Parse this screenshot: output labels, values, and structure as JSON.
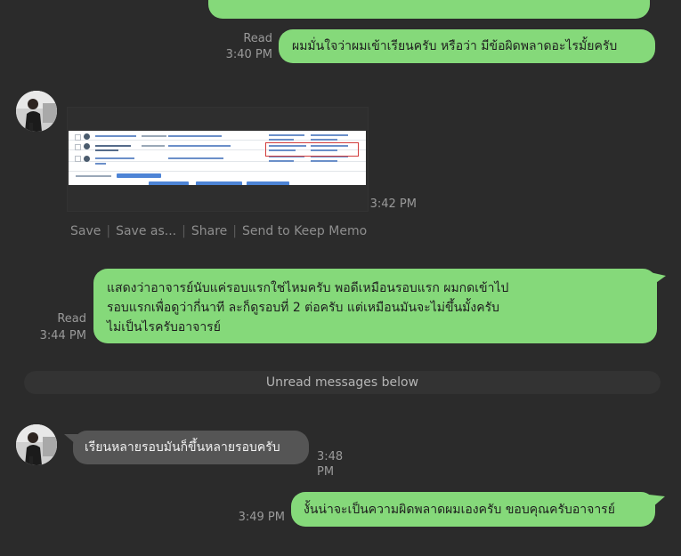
{
  "messages": [
    {
      "id": "m1",
      "from": "me",
      "text": "ผมมั่นใจว่าผมเข้าเรียนครับ หรือว่า มีข้อผิดพลาดอะไรมั้ยครับ",
      "read": "Read",
      "time": "3:40 PM"
    },
    {
      "id": "m2",
      "from": "other",
      "type": "image",
      "time": "3:42 PM"
    },
    {
      "id": "m3",
      "from": "me",
      "lines": [
        "แสดงว่าอาจารย์นับแค่รอบแรกใช่ไหมครับ พอดีเหมือนรอบแรก ผมกดเข้าไป",
        "รอบแรกเพื่อดูว่ากี่นาที ละก็ดูรอบที่ 2 ต่อครับ แต่เหมือนมันจะไม่ขึ้นมั้งครับ",
        "ไม่เป็นไรครับอาจารย์"
      ],
      "read": "Read",
      "time": "3:44 PM"
    },
    {
      "id": "m4",
      "from": "other",
      "text": "เรียนหลายรอบมันก็ขึ้นหลายรอบครับ",
      "time": "3:48 PM"
    },
    {
      "id": "m5",
      "from": "me",
      "text": "งั้นน่าจะเป็นความผิดพลาดผมเองครับ ขอบคุณครับอาจารย์",
      "time": "3:49 PM"
    }
  ],
  "image_actions": {
    "save": "Save",
    "save_as": "Save as...",
    "share": "Share",
    "keep_memo": "Send to Keep Memo"
  },
  "divider": "Unread messages below",
  "colors": {
    "background": "#2b2b2b",
    "outgoing_bubble": "#85d97a",
    "incoming_bubble": "#555555",
    "meta_text": "#9a9a9a"
  },
  "icons": [
    "avatar",
    "image-thumbnail"
  ]
}
